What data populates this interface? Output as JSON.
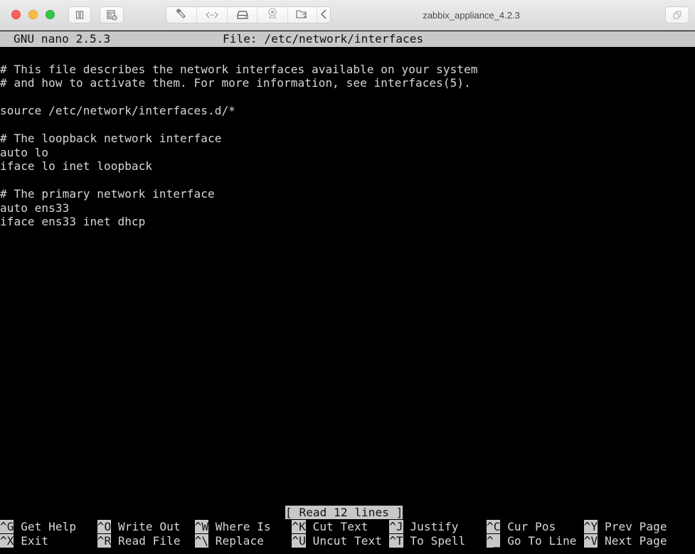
{
  "window": {
    "title": "zabbix_appliance_4.2.3",
    "toolbar_buttons": [
      {
        "name": "pause-icon",
        "label": "Pause"
      },
      {
        "name": "snapshot-icon",
        "label": "Snapshots"
      }
    ],
    "segmented_buttons": [
      {
        "name": "wrench-icon",
        "label": "Settings"
      },
      {
        "name": "network-icon",
        "label": "Network"
      },
      {
        "name": "disk-icon",
        "label": "Hard Disk"
      },
      {
        "name": "camera-icon",
        "label": "Camera"
      },
      {
        "name": "shared-folder-icon",
        "label": "Shared Folders"
      },
      {
        "name": "chevron-left-icon",
        "label": "Back"
      }
    ],
    "fullscreen_button": {
      "name": "restore-window-icon",
      "label": "Restore"
    }
  },
  "nano": {
    "version": "GNU nano 2.5.3",
    "file_label": "File: /etc/network/interfaces",
    "lines": [
      "",
      "# This file describes the network interfaces available on your system",
      "# and how to activate them. For more information, see interfaces(5).",
      "",
      "source /etc/network/interfaces.d/*",
      "",
      "# The loopback network interface",
      "auto lo",
      "iface lo inet loopback",
      "",
      "# The primary network interface",
      "auto ens33",
      "iface ens33 inet dhcp"
    ],
    "status": "[ Read 12 lines ]",
    "shortcuts_row1": [
      {
        "key": "^G",
        "label": "Get Help"
      },
      {
        "key": "^O",
        "label": "Write Out"
      },
      {
        "key": "^W",
        "label": "Where Is"
      },
      {
        "key": "^K",
        "label": "Cut Text"
      },
      {
        "key": "^J",
        "label": "Justify"
      },
      {
        "key": "^C",
        "label": "Cur Pos"
      },
      {
        "key": "^Y",
        "label": "Prev Page"
      }
    ],
    "shortcuts_row2": [
      {
        "key": "^X",
        "label": "Exit"
      },
      {
        "key": "^R",
        "label": "Read File"
      },
      {
        "key": "^\\",
        "label": "Replace"
      },
      {
        "key": "^U",
        "label": "Uncut Text"
      },
      {
        "key": "^T",
        "label": "To Spell"
      },
      {
        "key": "^_",
        "label": "Go To Line"
      },
      {
        "key": "^V",
        "label": "Next Page"
      }
    ]
  },
  "colors": {
    "terminal_bg": "#000000",
    "terminal_fg": "#d8d8d8",
    "inverse_bg": "#c8c8c8",
    "inverse_fg": "#111111",
    "close": "#fc605c",
    "minimize": "#fdbc40",
    "zoom": "#34c84a"
  }
}
